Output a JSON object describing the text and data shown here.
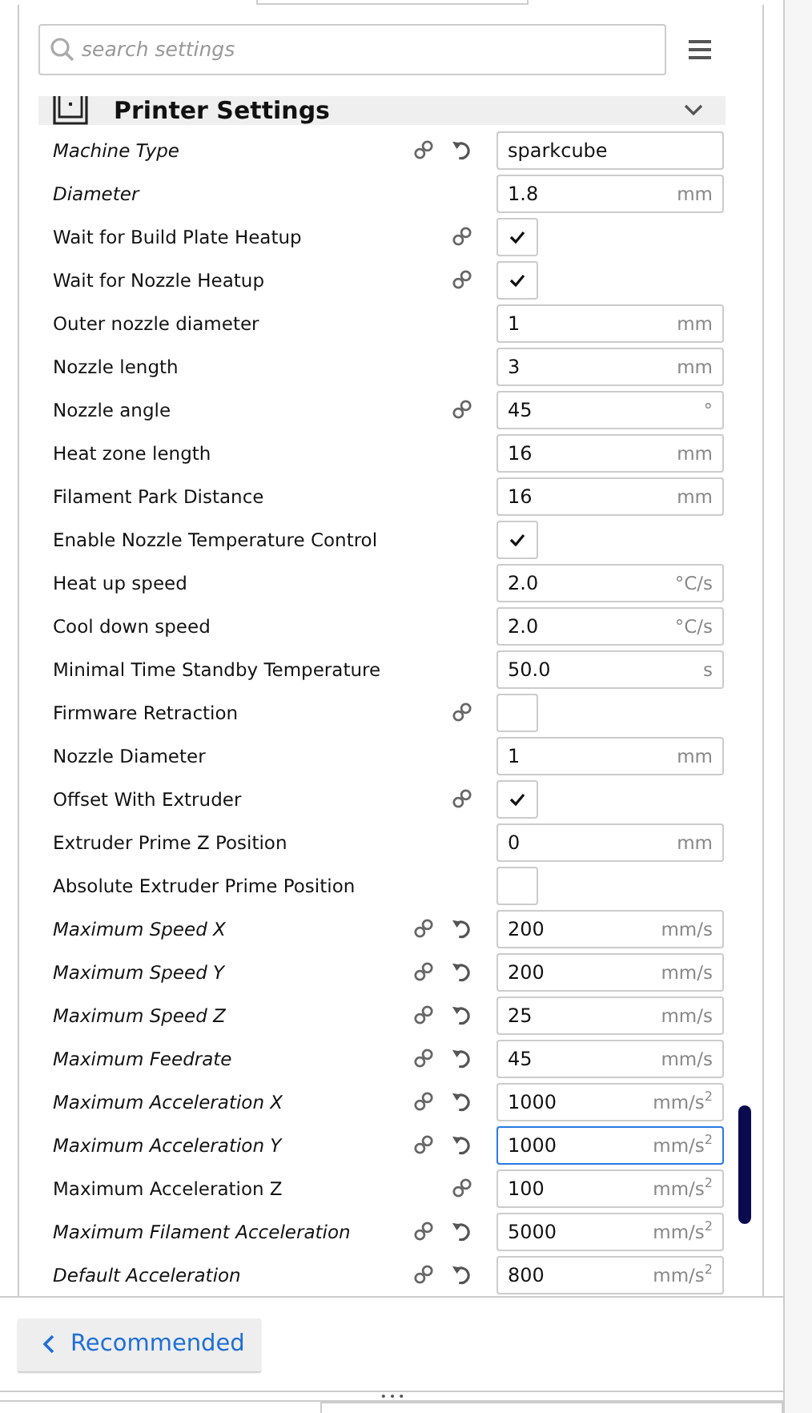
{
  "search": {
    "placeholder": "search settings"
  },
  "section": {
    "title": "Printer Settings",
    "expanded": true
  },
  "settings": [
    {
      "label": "Machine Type",
      "italic": true,
      "linked": true,
      "resettable": true,
      "kind": "text",
      "value": "sparkcube",
      "focused": false
    },
    {
      "label": "Diameter",
      "italic": true,
      "linked": false,
      "resettable": false,
      "kind": "text",
      "value": "1.8",
      "unit": "mm",
      "focused": false
    },
    {
      "label": "Wait for Build Plate Heatup",
      "italic": false,
      "linked": true,
      "resettable": false,
      "kind": "checkbox",
      "checked": true
    },
    {
      "label": "Wait for Nozzle Heatup",
      "italic": false,
      "linked": true,
      "resettable": false,
      "kind": "checkbox",
      "checked": true
    },
    {
      "label": "Outer nozzle diameter",
      "italic": false,
      "linked": false,
      "resettable": false,
      "kind": "text",
      "value": "1",
      "unit": "mm",
      "focused": false
    },
    {
      "label": "Nozzle length",
      "italic": false,
      "linked": false,
      "resettable": false,
      "kind": "text",
      "value": "3",
      "unit": "mm",
      "focused": false
    },
    {
      "label": "Nozzle angle",
      "italic": false,
      "linked": true,
      "resettable": false,
      "kind": "text",
      "value": "45",
      "unit": "°",
      "focused": false
    },
    {
      "label": "Heat zone length",
      "italic": false,
      "linked": false,
      "resettable": false,
      "kind": "text",
      "value": "16",
      "unit": "mm",
      "focused": false
    },
    {
      "label": "Filament Park Distance",
      "italic": false,
      "linked": false,
      "resettable": false,
      "kind": "text",
      "value": "16",
      "unit": "mm",
      "focused": false
    },
    {
      "label": "Enable Nozzle Temperature Control",
      "italic": false,
      "linked": false,
      "resettable": false,
      "kind": "checkbox",
      "checked": true
    },
    {
      "label": "Heat up speed",
      "italic": false,
      "linked": false,
      "resettable": false,
      "kind": "text",
      "value": "2.0",
      "unit": "°C/s",
      "focused": false
    },
    {
      "label": "Cool down speed",
      "italic": false,
      "linked": false,
      "resettable": false,
      "kind": "text",
      "value": "2.0",
      "unit": "°C/s",
      "focused": false
    },
    {
      "label": "Minimal Time Standby Temperature",
      "italic": false,
      "linked": false,
      "resettable": false,
      "kind": "text",
      "value": "50.0",
      "unit": "s",
      "focused": false
    },
    {
      "label": "Firmware Retraction",
      "italic": false,
      "linked": true,
      "resettable": false,
      "kind": "checkbox",
      "checked": false
    },
    {
      "label": "Nozzle Diameter",
      "italic": false,
      "linked": false,
      "resettable": false,
      "kind": "text",
      "value": "1",
      "unit": "mm",
      "focused": false
    },
    {
      "label": "Offset With Extruder",
      "italic": false,
      "linked": true,
      "resettable": false,
      "kind": "checkbox",
      "checked": true
    },
    {
      "label": "Extruder Prime Z Position",
      "italic": false,
      "linked": false,
      "resettable": false,
      "kind": "text",
      "value": "0",
      "unit": "mm",
      "focused": false
    },
    {
      "label": "Absolute Extruder Prime Position",
      "italic": false,
      "linked": false,
      "resettable": false,
      "kind": "checkbox",
      "checked": false
    },
    {
      "label": "Maximum Speed X",
      "italic": true,
      "linked": true,
      "resettable": true,
      "kind": "text",
      "value": "200",
      "unit": "mm/s",
      "focused": false
    },
    {
      "label": "Maximum Speed Y",
      "italic": true,
      "linked": true,
      "resettable": true,
      "kind": "text",
      "value": "200",
      "unit": "mm/s",
      "focused": false
    },
    {
      "label": "Maximum Speed Z",
      "italic": true,
      "linked": true,
      "resettable": true,
      "kind": "text",
      "value": "25",
      "unit": "mm/s",
      "focused": false
    },
    {
      "label": "Maximum Feedrate",
      "italic": true,
      "linked": true,
      "resettable": true,
      "kind": "text",
      "value": "45",
      "unit": "mm/s",
      "focused": false
    },
    {
      "label": "Maximum Acceleration X",
      "italic": true,
      "linked": true,
      "resettable": true,
      "kind": "text",
      "value": "1000",
      "unit": "mm/s$^{2}$",
      "focused": false
    },
    {
      "label": "Maximum Acceleration Y",
      "italic": true,
      "linked": true,
      "resettable": true,
      "kind": "text",
      "value": "1000",
      "unit": "mm/s$^{2}$",
      "focused": true
    },
    {
      "label": "Maximum Acceleration Z",
      "italic": false,
      "linked": true,
      "resettable": false,
      "kind": "text",
      "value": "100",
      "unit": "mm/s$^{2}$",
      "focused": false
    },
    {
      "label": "Maximum Filament Acceleration",
      "italic": true,
      "linked": true,
      "resettable": true,
      "kind": "text",
      "value": "5000",
      "unit": "mm/s$^{2}$",
      "focused": false
    },
    {
      "label": "Default Acceleration",
      "italic": true,
      "linked": true,
      "resettable": true,
      "kind": "text",
      "value": "800",
      "unit": "mm/s$^{2}$",
      "focused": false
    }
  ],
  "footer": {
    "button": "Recommended"
  }
}
